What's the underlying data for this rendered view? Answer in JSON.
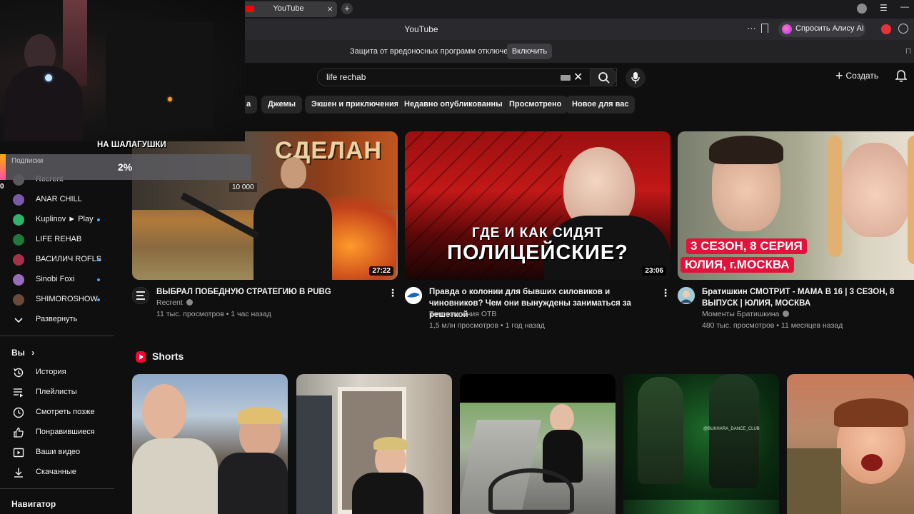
{
  "browser": {
    "tab_title": "YouTube",
    "address_title": "YouTube",
    "alice_label": "Спросить Алису AI",
    "banner_text": "Защита от вредоносных программ отключена",
    "banner_button": "Включить"
  },
  "header": {
    "search_value": "life rechab",
    "create_label": "Создать"
  },
  "chips": [
    {
      "label": "Джемы"
    },
    {
      "label": "Экшен и приключения"
    },
    {
      "label": "Недавно опубликованные"
    },
    {
      "label": "Просмотрено"
    },
    {
      "label": "Новое для вас"
    }
  ],
  "chip_partial": "а",
  "sidebar": {
    "subscriptions": [
      {
        "label": "Recrent"
      },
      {
        "label": "ANAR CHILL"
      },
      {
        "label": "Kuplinov ► Play"
      },
      {
        "label": "LIFE REHAB"
      },
      {
        "label": "ВАСИЛИЧ ROFLS"
      },
      {
        "label": "Sinobi Foxi"
      },
      {
        "label": "SHIMOROSHOW"
      }
    ],
    "expand_label": "Развернуть",
    "you_heading": "Вы",
    "you_items": [
      {
        "label": "История",
        "icon": "history-icon"
      },
      {
        "label": "Плейлисты",
        "icon": "playlist-icon"
      },
      {
        "label": "Смотреть позже",
        "icon": "clock-icon"
      },
      {
        "label": "Понравившиеся",
        "icon": "thumb-up-icon"
      },
      {
        "label": "Ваши видео",
        "icon": "video-icon"
      },
      {
        "label": "Скачанные",
        "icon": "download-icon"
      }
    ],
    "navigator_heading": "Навигатор"
  },
  "videos": [
    {
      "title": "ВЫБРАЛ ПОБЕДНУЮ СТРАТЕГИЮ В PUBG",
      "channel": "Recrent",
      "meta": "11 тыс. просмотров • 1 час назад",
      "duration": "27:22",
      "thumb_text": "СДЕЛАН",
      "thumb_badge": "10 000"
    },
    {
      "title": "Правда о колонии для бывших силовиков и чиновников? Чем они вынуждены заниматься за решеткой",
      "channel": "Телекомпания ОТВ",
      "meta": "1,5 млн просмотров • 1 год назад",
      "duration": "23:06",
      "thumb_line1": "ГДЕ И КАК СИДЯТ",
      "thumb_line2": "ПОЛИЦЕЙСКИЕ?"
    },
    {
      "title": "Братишкин СМОТРИТ - МАМА В 16 | 3 СЕЗОН, 8 ВЫПУСК | ЮЛИЯ, МОСКВА",
      "channel": "Моменты Братишкина",
      "meta": "480 тыс. просмотров • 11 месяцев назад",
      "thumb_line1": "3 СЕЗОН, 8 СЕРИЯ",
      "thumb_line2": "ЮЛИЯ, г.МОСКВА"
    }
  ],
  "shorts": {
    "heading": "Shorts"
  },
  "stream_overlay": {
    "cam_name": "НА ШАЛАГУШКИ",
    "goal_label": "Подписки",
    "goal_percent": "2%",
    "goal_progress": 0.02,
    "goal_start": "0"
  },
  "colors": {
    "youtube_red": "#ff0000",
    "background": "#0f0f0f",
    "chip": "#272727",
    "accent_blue": "#3ea6ff"
  }
}
